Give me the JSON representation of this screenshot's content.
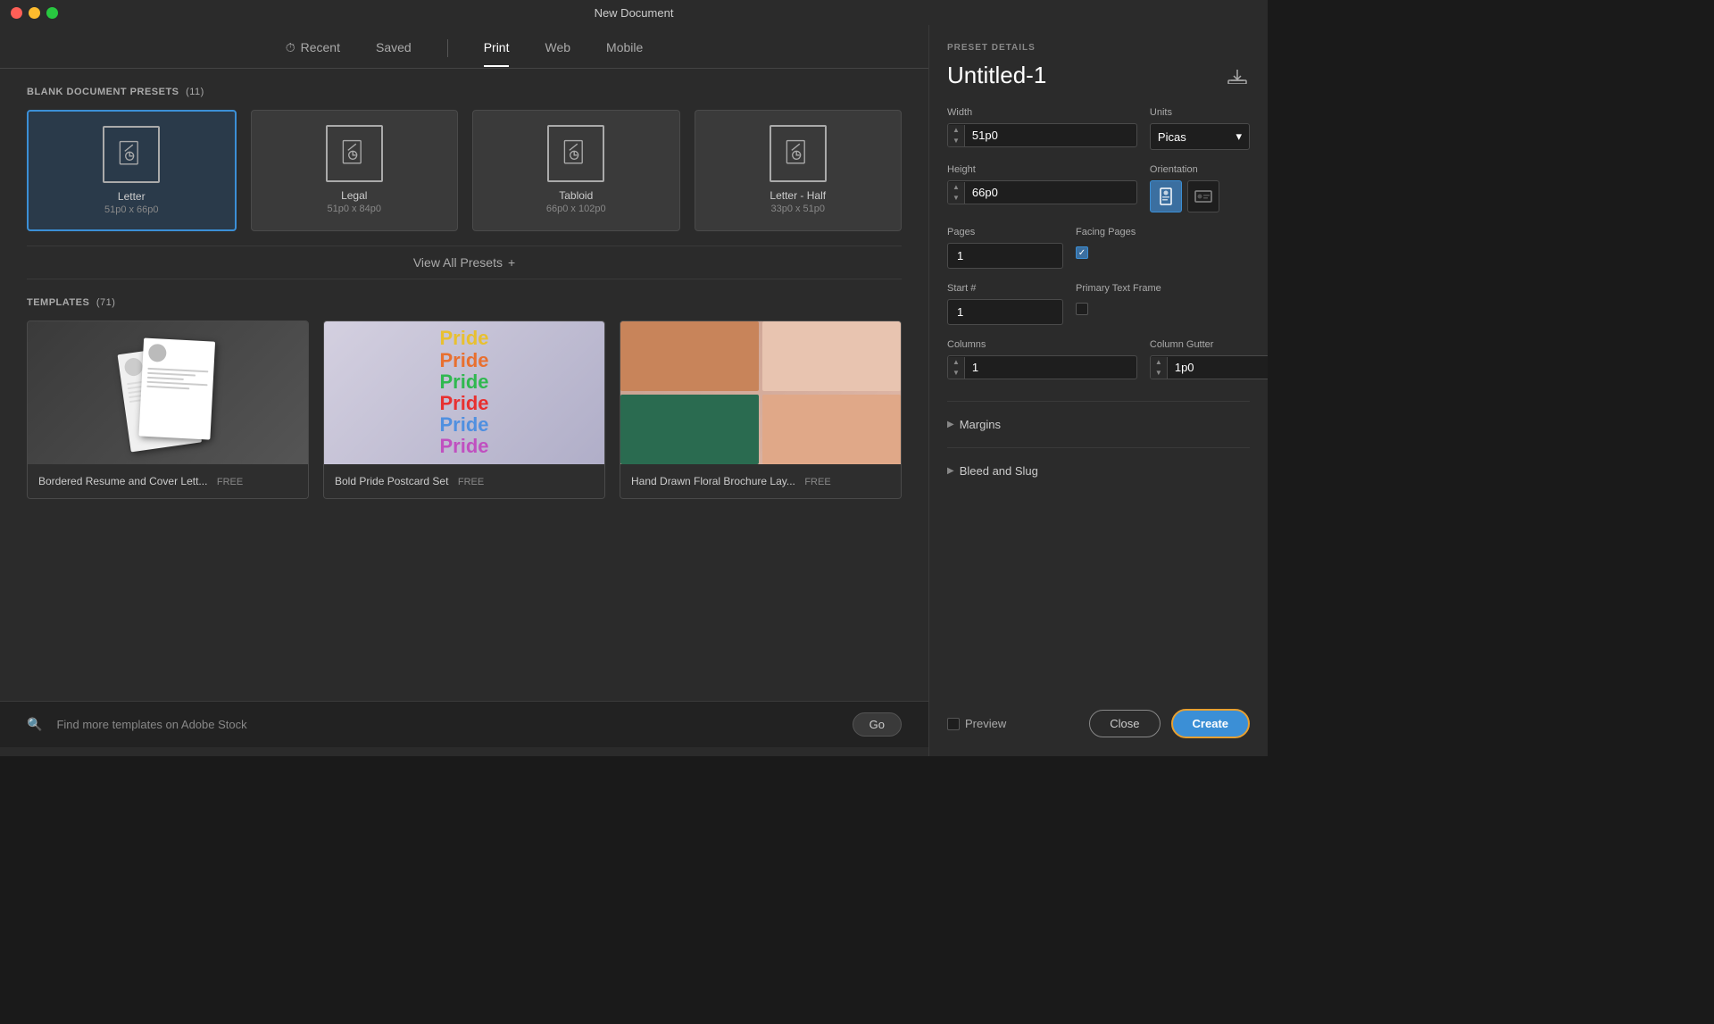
{
  "titleBar": {
    "title": "New Document"
  },
  "tabs": [
    {
      "id": "recent",
      "label": "Recent",
      "icon": "clock",
      "active": false
    },
    {
      "id": "saved",
      "label": "Saved",
      "active": false
    },
    {
      "id": "print",
      "label": "Print",
      "active": true
    },
    {
      "id": "web",
      "label": "Web",
      "active": false
    },
    {
      "id": "mobile",
      "label": "Mobile",
      "active": false
    }
  ],
  "presetsSection": {
    "header": "BLANK DOCUMENT PRESETS",
    "count": "(11)",
    "presets": [
      {
        "id": "letter",
        "name": "Letter",
        "size": "51p0 x 66p0",
        "selected": true
      },
      {
        "id": "legal",
        "name": "Legal",
        "size": "51p0 x 84p0",
        "selected": false
      },
      {
        "id": "tabloid",
        "name": "Tabloid",
        "size": "66p0 x 102p0",
        "selected": false
      },
      {
        "id": "letter-half",
        "name": "Letter - Half",
        "size": "33p0 x 51p0",
        "selected": false
      }
    ],
    "viewAllLabel": "View All Presets",
    "viewAllIcon": "+"
  },
  "templatesSection": {
    "header": "TEMPLATES",
    "count": "(71)",
    "templates": [
      {
        "id": "resume",
        "name": "Bordered Resume and Cover Lett...",
        "badge": "FREE",
        "type": "resume"
      },
      {
        "id": "pride",
        "name": "Bold Pride Postcard Set",
        "badge": "FREE",
        "type": "pride"
      },
      {
        "id": "floral",
        "name": "Hand Drawn Floral Brochure Lay...",
        "badge": "FREE",
        "type": "floral"
      }
    ]
  },
  "searchBar": {
    "placeholder": "Find more templates on Adobe Stock",
    "goLabel": "Go"
  },
  "rightPanel": {
    "presetDetailsLabel": "PRESET DETAILS",
    "docTitle": "Untitled-1",
    "width": {
      "label": "Width",
      "value": "51p0"
    },
    "units": {
      "label": "Units",
      "value": "Picas"
    },
    "height": {
      "label": "Height",
      "value": "66p0"
    },
    "orientation": {
      "label": "Orientation",
      "portrait": "Portrait",
      "landscape": "Landscape"
    },
    "pages": {
      "label": "Pages",
      "value": "1"
    },
    "facingPages": {
      "label": "Facing Pages",
      "checked": true
    },
    "startHash": {
      "label": "Start #",
      "value": "1"
    },
    "primaryTextFrame": {
      "label": "Primary Text Frame",
      "checked": false
    },
    "columns": {
      "label": "Columns",
      "value": "1"
    },
    "columnGutter": {
      "label": "Column Gutter",
      "value": "1p0"
    },
    "margins": {
      "label": "Margins"
    },
    "bleedAndSlug": {
      "label": "Bleed and Slug"
    },
    "preview": {
      "label": "Preview",
      "checked": false
    },
    "closeLabel": "Close",
    "createLabel": "Create"
  }
}
